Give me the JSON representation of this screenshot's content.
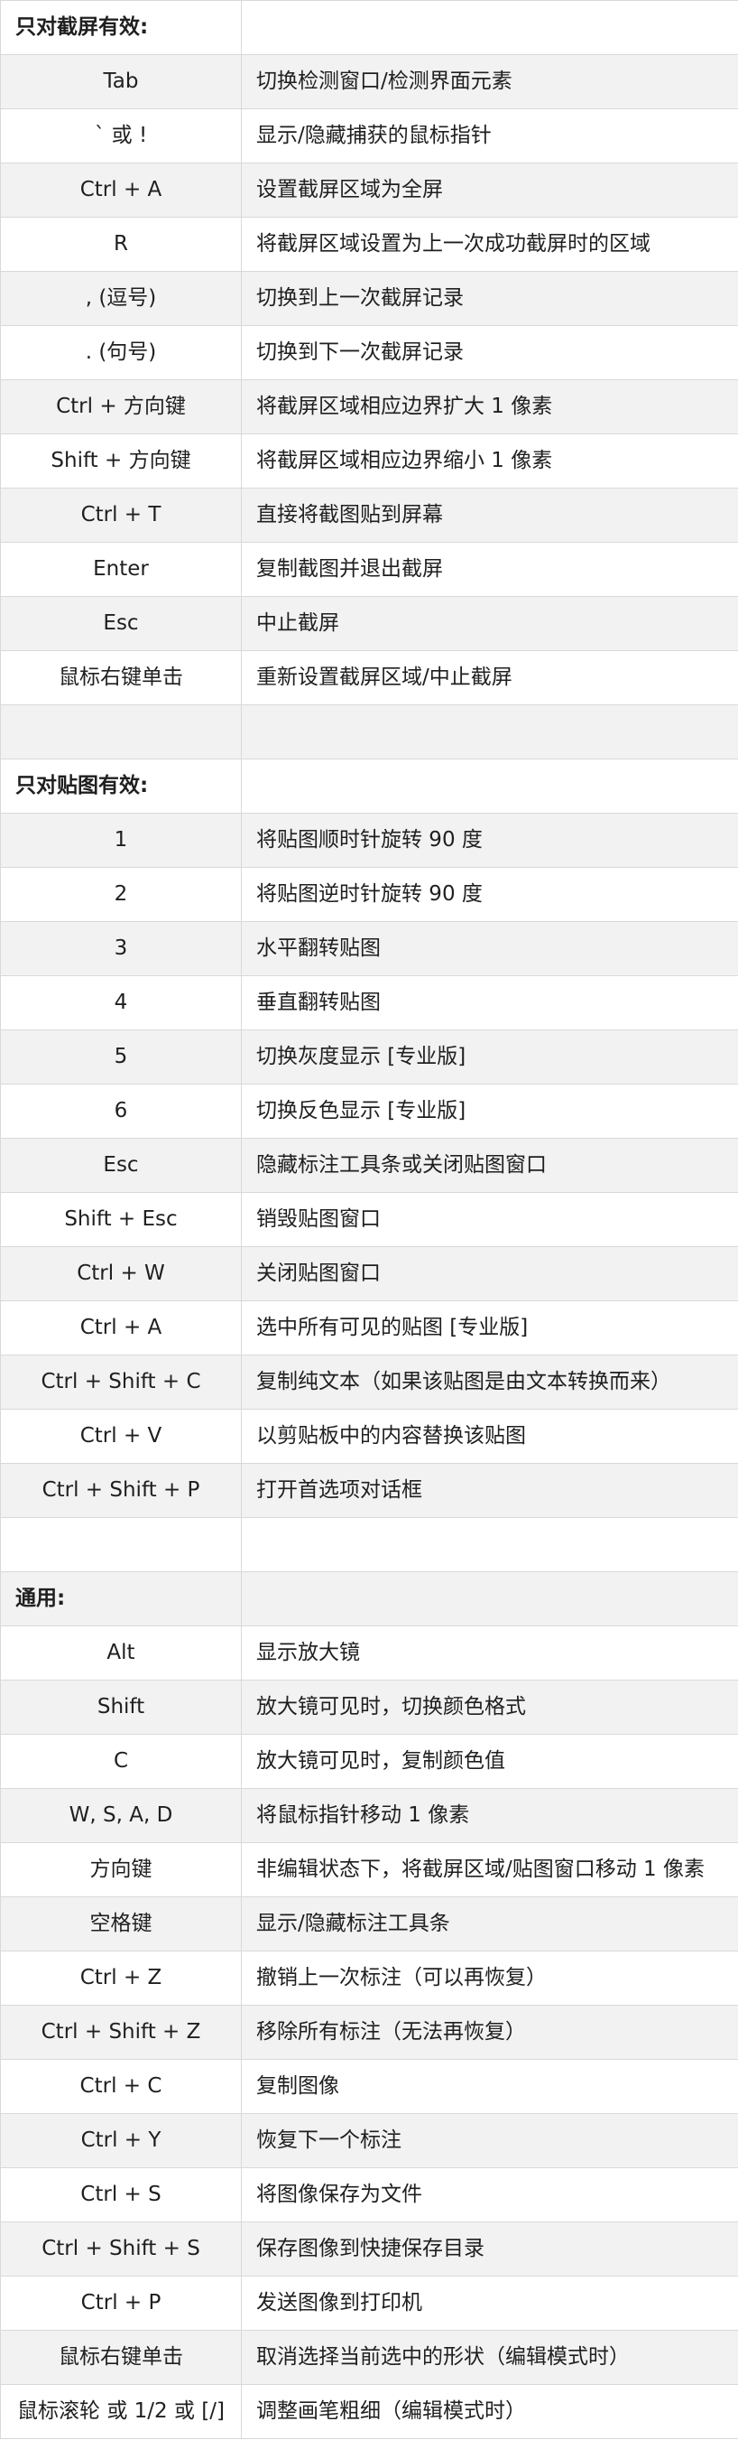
{
  "rows": [
    {
      "type": "header",
      "text": "只对截屏有效:"
    },
    {
      "type": "item",
      "key": "Tab",
      "desc": "切换检测窗口/检测界面元素"
    },
    {
      "type": "item",
      "key": "` 或 !",
      "desc": "显示/隐藏捕获的鼠标指针"
    },
    {
      "type": "item",
      "key": "Ctrl + A",
      "desc": "设置截屏区域为全屏"
    },
    {
      "type": "item",
      "key": "R",
      "desc": "将截屏区域设置为上一次成功截屏时的区域"
    },
    {
      "type": "item",
      "key": ", (逗号)",
      "desc": "切换到上一次截屏记录"
    },
    {
      "type": "item",
      "key": ". (句号)",
      "desc": "切换到下一次截屏记录"
    },
    {
      "type": "item",
      "key": "Ctrl + 方向键",
      "desc": "将截屏区域相应边界扩大 1 像素"
    },
    {
      "type": "item",
      "key": "Shift + 方向键",
      "desc": "将截屏区域相应边界缩小 1 像素"
    },
    {
      "type": "item",
      "key": "Ctrl + T",
      "desc": "直接将截图贴到屏幕"
    },
    {
      "type": "item",
      "key": "Enter",
      "desc": "复制截图并退出截屏"
    },
    {
      "type": "item",
      "key": "Esc",
      "desc": "中止截屏"
    },
    {
      "type": "item",
      "key": "鼠标右键单击",
      "desc": "重新设置截屏区域/中止截屏"
    },
    {
      "type": "blank"
    },
    {
      "type": "header",
      "text": "只对贴图有效:"
    },
    {
      "type": "item",
      "key": "1",
      "desc": "将贴图顺时针旋转 90 度"
    },
    {
      "type": "item",
      "key": "2",
      "desc": "将贴图逆时针旋转 90 度"
    },
    {
      "type": "item",
      "key": "3",
      "desc": "水平翻转贴图"
    },
    {
      "type": "item",
      "key": "4",
      "desc": "垂直翻转贴图"
    },
    {
      "type": "item",
      "key": "5",
      "desc": "切换灰度显示 [专业版]"
    },
    {
      "type": "item",
      "key": "6",
      "desc": "切换反色显示 [专业版]"
    },
    {
      "type": "item",
      "key": "Esc",
      "desc": "隐藏标注工具条或关闭贴图窗口"
    },
    {
      "type": "item",
      "key": "Shift + Esc",
      "desc": "销毁贴图窗口"
    },
    {
      "type": "item",
      "key": "Ctrl + W",
      "desc": "关闭贴图窗口"
    },
    {
      "type": "item",
      "key": "Ctrl + A",
      "desc": "选中所有可见的贴图 [专业版]"
    },
    {
      "type": "item",
      "key": "Ctrl + Shift + C",
      "desc": "复制纯文本（如果该贴图是由文本转换而来）"
    },
    {
      "type": "item",
      "key": "Ctrl + V",
      "desc": "以剪贴板中的内容替换该贴图"
    },
    {
      "type": "item",
      "key": "Ctrl + Shift + P",
      "desc": "打开首选项对话框"
    },
    {
      "type": "blank"
    },
    {
      "type": "header",
      "text": "通用:"
    },
    {
      "type": "item",
      "key": "Alt",
      "desc": "显示放大镜"
    },
    {
      "type": "item",
      "key": "Shift",
      "desc": "放大镜可见时，切换颜色格式"
    },
    {
      "type": "item",
      "key": "C",
      "desc": "放大镜可见时，复制颜色值"
    },
    {
      "type": "item",
      "key": "W, S, A, D",
      "desc": "将鼠标指针移动 1 像素"
    },
    {
      "type": "item",
      "key": "方向键",
      "desc": "非编辑状态下，将截屏区域/贴图窗口移动 1 像素"
    },
    {
      "type": "item",
      "key": "空格键",
      "desc": "显示/隐藏标注工具条"
    },
    {
      "type": "item",
      "key": "Ctrl + Z",
      "desc": "撤销上一次标注（可以再恢复）"
    },
    {
      "type": "item",
      "key": "Ctrl + Shift + Z",
      "desc": "移除所有标注（无法再恢复）"
    },
    {
      "type": "item",
      "key": "Ctrl + C",
      "desc": "复制图像"
    },
    {
      "type": "item",
      "key": "Ctrl + Y",
      "desc": "恢复下一个标注"
    },
    {
      "type": "item",
      "key": "Ctrl + S",
      "desc": "将图像保存为文件"
    },
    {
      "type": "item",
      "key": "Ctrl + Shift + S",
      "desc": "保存图像到快捷保存目录"
    },
    {
      "type": "item",
      "key": "Ctrl + P",
      "desc": "发送图像到打印机"
    },
    {
      "type": "item",
      "key": "鼠标右键单击",
      "desc": "取消选择当前选中的形状（编辑模式时）"
    },
    {
      "type": "item",
      "key": "鼠标滚轮 或 1/2 或 [/]",
      "desc": "调整画笔粗细（编辑模式时）"
    }
  ]
}
